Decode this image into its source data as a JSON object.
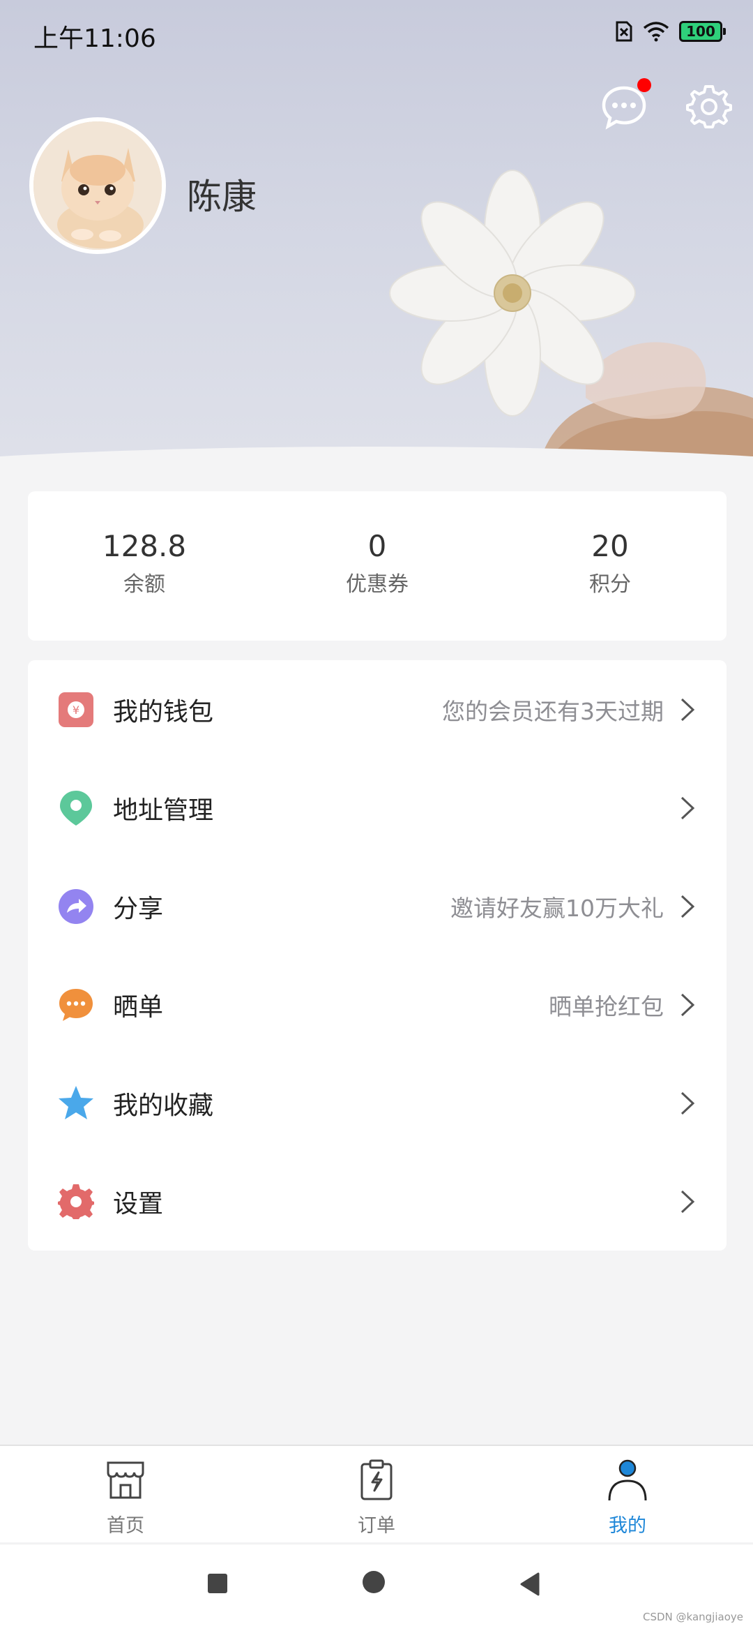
{
  "status_bar": {
    "time": "上午11:06",
    "battery": "100"
  },
  "profile": {
    "name": "陈康"
  },
  "stats": [
    {
      "value": "128.8",
      "label": "余额"
    },
    {
      "value": "0",
      "label": "优惠券"
    },
    {
      "value": "20",
      "label": "积分"
    }
  ],
  "menu": [
    {
      "label": "我的钱包",
      "hint": "您的会员还有3天过期",
      "icon": "wallet-icon",
      "color": "#e47a7a"
    },
    {
      "label": "地址管理",
      "hint": "",
      "icon": "location-pin-icon",
      "color": "#5cc89a"
    },
    {
      "label": "分享",
      "hint": "邀请好友赢10万大礼",
      "icon": "share-icon",
      "color": "#9384f0"
    },
    {
      "label": "晒单",
      "hint": "晒单抢红包",
      "icon": "chat-bubble-icon",
      "color": "#f0903c"
    },
    {
      "label": "我的收藏",
      "hint": "",
      "icon": "star-icon",
      "color": "#4aa8ea"
    },
    {
      "label": "设置",
      "hint": "",
      "icon": "gear-icon",
      "color": "#e26a6a"
    }
  ],
  "tabs": [
    {
      "label": "首页",
      "icon": "store-icon",
      "active": false
    },
    {
      "label": "订单",
      "icon": "clipboard-icon",
      "active": false
    },
    {
      "label": "我的",
      "icon": "user-icon",
      "active": true
    }
  ],
  "active_color": "#1e87d8",
  "watermark": "CSDN @kangjiaoye"
}
